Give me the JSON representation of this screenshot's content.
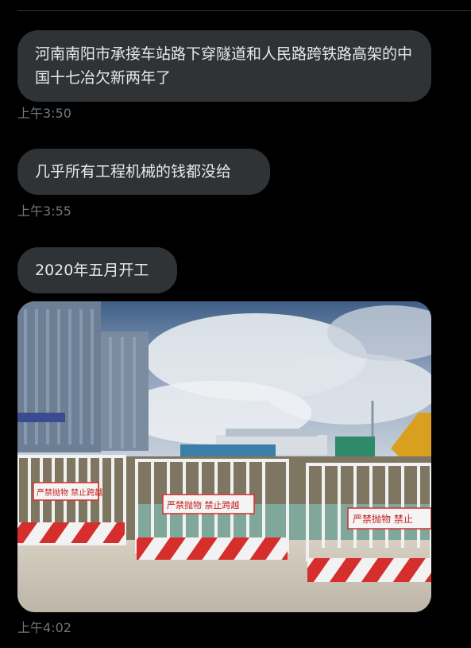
{
  "messages": [
    {
      "text": "河南南阳市承接车站路下穿隧道和人民路跨铁路高架的中国十七冶欠新两年了",
      "time": "上午3:50"
    },
    {
      "text": "几乎所有工程机械的钱都没给",
      "time": "上午3:55"
    },
    {
      "text": "2020年五月开工",
      "time": ""
    }
  ],
  "photo": {
    "time": "上午4:02",
    "signs": [
      "严禁抛物  禁止跨越",
      "严禁抛物  禁止跨越",
      "严禁抛物  禁止"
    ]
  },
  "colors": {
    "background": "#000000",
    "bubble": "#2f3336",
    "text": "#e7e9ea",
    "muted": "#71767b",
    "barrier_red": "#d62d2d"
  }
}
